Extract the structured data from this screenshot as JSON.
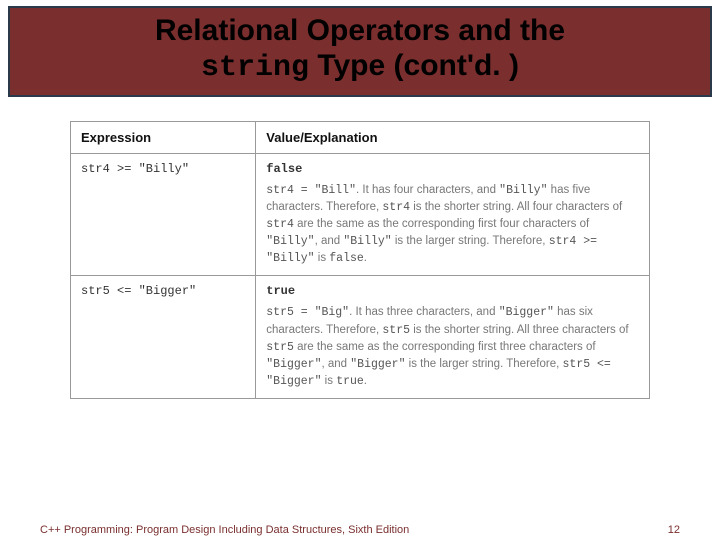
{
  "title": {
    "line1": "Relational Operators and the",
    "code_word": "string",
    "line2_rest": " Type (cont'd. )"
  },
  "table": {
    "headers": {
      "col1": "Expression",
      "col2": "Value/Explanation"
    },
    "rows": [
      {
        "expression": "str4 >= \"Billy\"",
        "value": "false",
        "explanation_html": "<span class='c'>str4 = \"Bill\"</span>. It has four characters, and <span class='c'>\"Billy\"</span> has five characters. Therefore, <span class='c'>str4</span> is the shorter string. All four characters of <span class='c'>str4</span> are the same as the corresponding first four characters of <span class='c'>\"Billy\"</span>, and <span class='c'>\"Billy\"</span> is the larger string. Therefore, <span class='c'>str4 &gt;= \"Billy\"</span> is <span class='c'>false</span>."
      },
      {
        "expression": "str5 <= \"Bigger\"",
        "value": "true",
        "explanation_html": "<span class='c'>str5 = \"Big\"</span>. It has three characters, and <span class='c'>\"Bigger\"</span> has six characters. Therefore, <span class='c'>str5</span> is the shorter string. All three characters of <span class='c'>str5</span> are the same as the corresponding first three characters of <span class='c'>\"Bigger\"</span>, and <span class='c'>\"Bigger\"</span> is the larger string. Therefore, <span class='c'>str5 &lt;= \"Bigger\"</span> is <span class='c'>true</span>."
      }
    ]
  },
  "footer": {
    "left": "C++ Programming: Program Design Including Data Structures, Sixth Edition",
    "right": "12"
  }
}
